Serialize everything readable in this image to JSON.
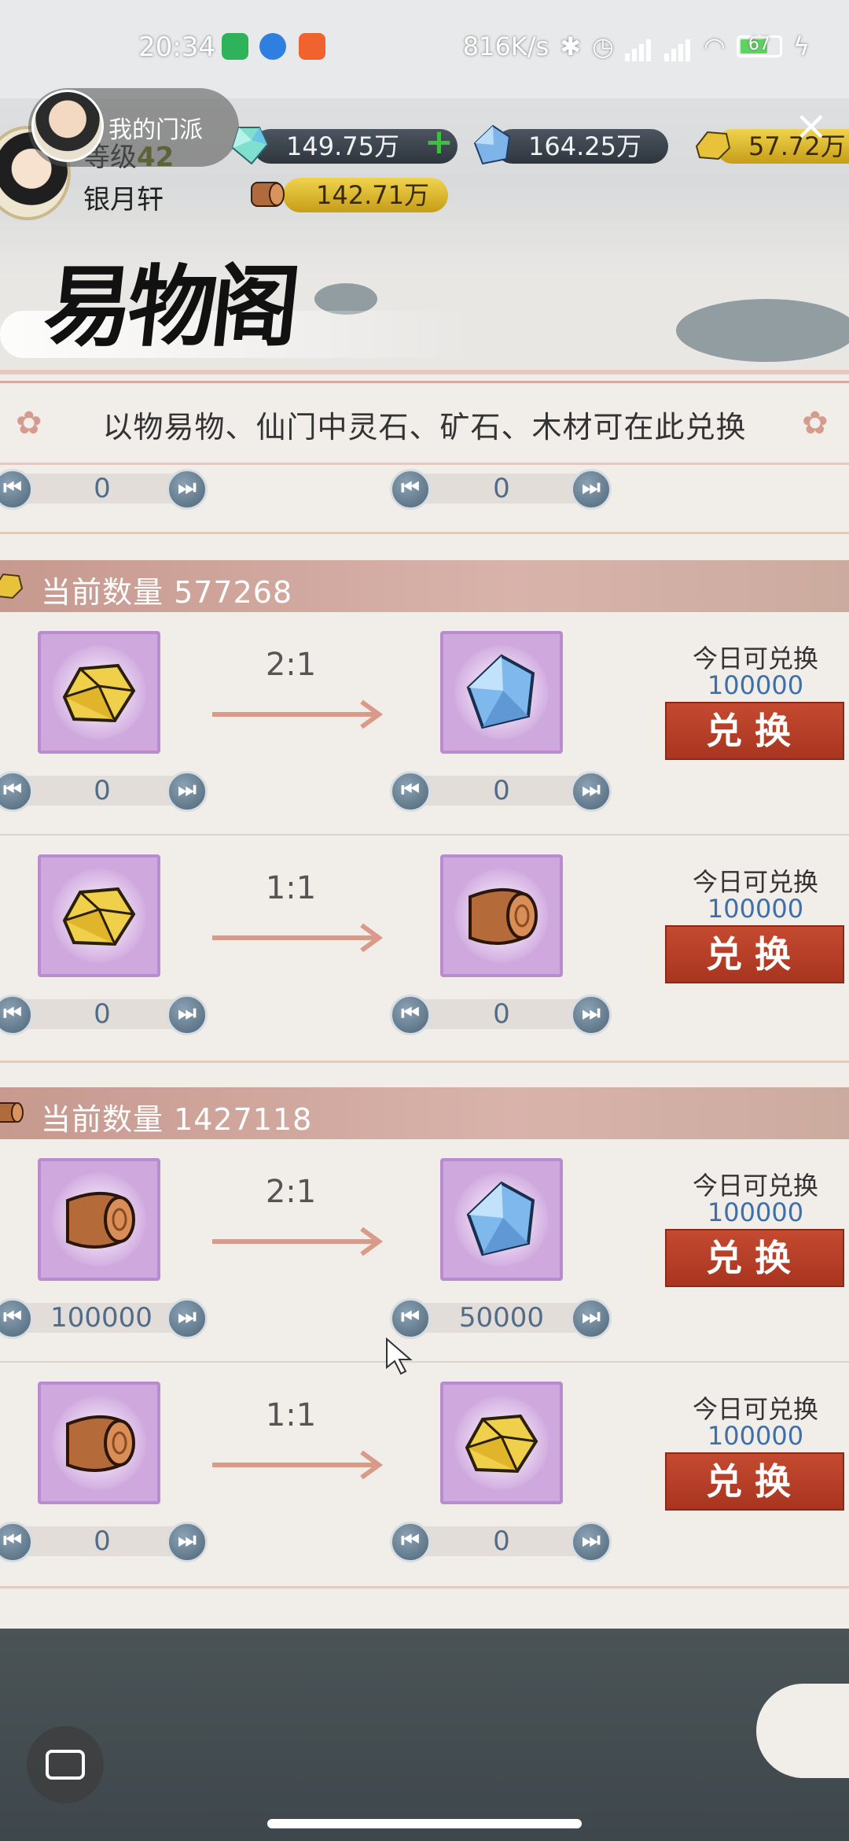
{
  "status_bar": {
    "time": "20:34",
    "net_speed": "816K/s",
    "battery": "67"
  },
  "header": {
    "sect_button": "我的门派",
    "level_prefix": "等级",
    "level": "42",
    "player_name": "银月轩",
    "resources": {
      "spirit_stone": "149.75万",
      "ore": "164.25万",
      "gold": "57.72万",
      "wood": "142.71万"
    }
  },
  "page": {
    "title": "易物阁",
    "notice": "以物易物、仙门中灵石、矿石、木材可在此兑换"
  },
  "top_stepper_values": [
    "0",
    "0"
  ],
  "sections": [
    {
      "header": "当前数量 577268",
      "source_icon": "gold-ore-icon",
      "rows": [
        {
          "ratio": "2:1",
          "from_icon": "gold-ore-icon",
          "to_icon": "crystal-icon",
          "quota_label": "今日可兑换",
          "quota_value": "100000",
          "button": "兑换",
          "from_value": "0",
          "to_value": "0"
        },
        {
          "ratio": "1:1",
          "from_icon": "gold-ore-icon",
          "to_icon": "wood-log-icon",
          "quota_label": "今日可兑换",
          "quota_value": "100000",
          "button": "兑换",
          "from_value": "0",
          "to_value": "0"
        }
      ]
    },
    {
      "header": "当前数量 1427118",
      "source_icon": "wood-log-icon",
      "rows": [
        {
          "ratio": "2:1",
          "from_icon": "wood-log-icon",
          "to_icon": "crystal-icon",
          "quota_label": "今日可兑换",
          "quota_value": "100000",
          "button": "兑换",
          "from_value": "100000",
          "to_value": "50000"
        },
        {
          "ratio": "1:1",
          "from_icon": "wood-log-icon",
          "to_icon": "gold-ore-icon",
          "quota_label": "今日可兑换",
          "quota_value": "100000",
          "button": "兑换",
          "from_value": "0",
          "to_value": "0"
        }
      ]
    }
  ],
  "colors": {
    "section_header": "#c7998f",
    "exchange_button": "#b33d25",
    "quota_value": "#3f6fa8",
    "item_frame": "#cfa8de"
  }
}
